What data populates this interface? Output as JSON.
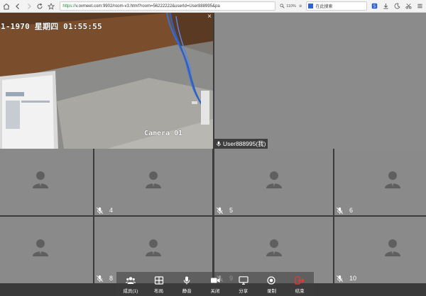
{
  "browser": {
    "url_scheme": "https://",
    "url_rest": "v.ovmeet.com:9902/room-v3.html?room=56222222&userId=User888995&pa",
    "zoom": "110%",
    "search_placeholder": "在此搜索"
  },
  "camera_tile": {
    "timestamp": "1-1970 星期四 01:55:55",
    "camera_label": "Camera 01",
    "close_glyph": "×"
  },
  "self_tile": {
    "name": "User888995(我)"
  },
  "participants": [
    {
      "number": ""
    },
    {
      "number": "4"
    },
    {
      "number": "5"
    },
    {
      "number": "6"
    },
    {
      "number": ""
    },
    {
      "number": "8"
    },
    {
      "number": "9"
    },
    {
      "number": "10"
    }
  ],
  "toolbar": {
    "members_label": "成员(1)",
    "layout_label": "布局",
    "mute_label": "静音",
    "video_off_label": "关闭",
    "share_label": "分享",
    "record_label": "录制",
    "end_label": "结束"
  },
  "colors": {
    "tile_bg": "#8a8a8a",
    "stage_bg": "#3c3c3c",
    "end_red": "#e53935",
    "url_green": "#1a8a2e"
  }
}
